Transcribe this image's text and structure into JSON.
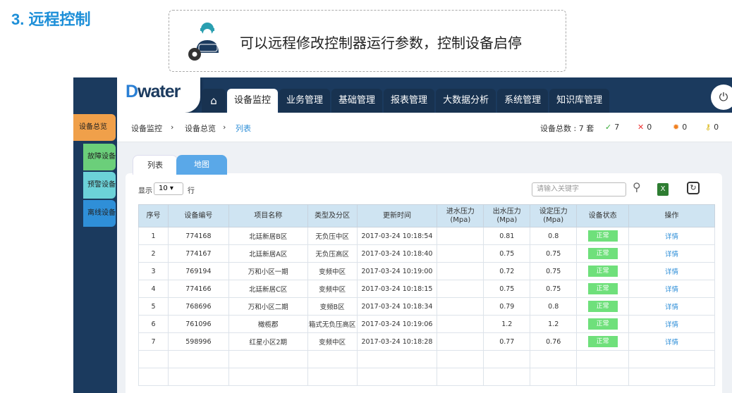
{
  "heading": "3. 远程控制",
  "callout": "可以远程修改控制器运行参数，控制设备启停",
  "app": {
    "logo": {
      "d": "D",
      "rest": "water"
    },
    "nav": [
      "设备监控",
      "业务管理",
      "基础管理",
      "报表管理",
      "大数据分析",
      "系统管理",
      "知识库管理"
    ],
    "home_icon": "⌂",
    "power_icon": "⏻",
    "side": [
      "设备总览",
      "故障设备",
      "预警设备",
      "离线设备"
    ],
    "breadcrumb": [
      "设备监控",
      "›",
      "设备总览",
      "›",
      "列表"
    ],
    "stats": {
      "total": "设备总数 : 7 套",
      "ok_icon": "✓",
      "ok": "7",
      "err_icon": "✕",
      "err": "0",
      "warn_icon": "✹",
      "warn": "0",
      "off_icon": "⚷",
      "off": "0"
    },
    "tabs": [
      "列表",
      "地图"
    ],
    "show": "显示",
    "page_size": "10 ▾",
    "rows": "行",
    "search_placeholder": "请输入关键字",
    "columns": [
      "序号",
      "设备编号",
      "项目名称",
      "类型及分区",
      "更新时间",
      "进水压力\n(Mpa)",
      "出水压力\n(Mpa)",
      "设定压力\n(Mpa)",
      "设备状态",
      "操作"
    ],
    "rows_data": [
      [
        "1",
        "774168",
        "北廷新居B区",
        "无负压中区",
        "2017-03-24 10:18:54",
        "",
        "0.81",
        "0.8",
        "正常",
        "详情"
      ],
      [
        "2",
        "774167",
        "北廷新居A区",
        "无负压高区",
        "2017-03-24 10:18:40",
        "",
        "0.75",
        "0.75",
        "正常",
        "详情"
      ],
      [
        "3",
        "769194",
        "万和小区一期",
        "变频中区",
        "2017-03-24 10:19:00",
        "",
        "0.72",
        "0.75",
        "正常",
        "详情"
      ],
      [
        "4",
        "774166",
        "北廷新居C区",
        "变频中区",
        "2017-03-24 10:18:15",
        "",
        "0.75",
        "0.75",
        "正常",
        "详情"
      ],
      [
        "5",
        "768696",
        "万和小区二期",
        "变频B区",
        "2017-03-24 10:18:34",
        "",
        "0.79",
        "0.8",
        "正常",
        "详情"
      ],
      [
        "6",
        "761096",
        "橄榄郡",
        "箱式无负压高区",
        "2017-03-24 10:19:06",
        "",
        "1.2",
        "1.2",
        "正常",
        "详情"
      ],
      [
        "7",
        "598996",
        "红星小区2期",
        "变频中区",
        "2017-03-24 10:18:28",
        "",
        "0.77",
        "0.76",
        "正常",
        "详情"
      ]
    ]
  }
}
